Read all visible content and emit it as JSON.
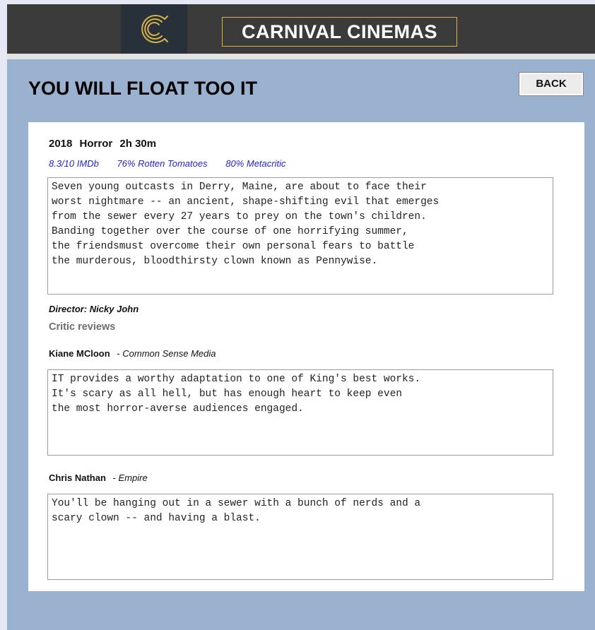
{
  "header": {
    "logo_icon": "c-monogram-logo",
    "brand": "CARNIVAL CINEMAS",
    "colors": {
      "bar": "#3b3b3b",
      "logo_bg": "#28313a",
      "accent": "#d8b24a"
    }
  },
  "page": {
    "title": "YOU WILL FLOAT TOO IT",
    "back_label": "BACK",
    "background": "#9ab2d0"
  },
  "movie": {
    "year": "2018",
    "genre": "Horror",
    "runtime": "2h 30m",
    "ratings": {
      "imdb": "8.3/10 IMDb",
      "rotten_tomatoes": "76% Rotten Tomatoes",
      "metacritic": "80% Metacritic"
    },
    "synopsis": "Seven young outcasts in Derry, Maine, are about to face their\nworst nightmare -- an ancient, shape-shifting evil that emerges\nfrom the sewer every 27 years to prey on the town's children.\nBanding together over the course of one horrifying summer,\nthe friendsmust overcome their own personal fears to battle\nthe murderous, bloodthirsty clown known as Pennywise.",
    "director": "Director: Nicky John"
  },
  "reviews": {
    "heading": "Critic reviews",
    "items": [
      {
        "critic": "Kiane MCloon",
        "separator": "-",
        "source": "Common Sense  Media",
        "text": "IT provides a worthy adaptation to one of King's best works.\nIt's scary as all hell, but has enough heart to keep even\nthe most horror-averse audiences engaged."
      },
      {
        "critic": "Chris Nathan",
        "separator": "-",
        "source": "Empire",
        "text": "You'll be hanging out in a sewer with a bunch of nerds and a\nscary clown -- and having a blast."
      }
    ]
  }
}
